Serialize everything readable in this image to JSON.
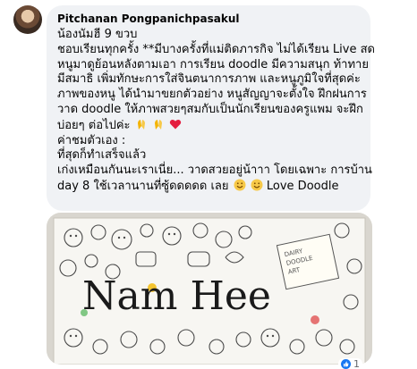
{
  "comment": {
    "author": "Pitchanan Pongpanichpasakul",
    "lines": [
      "น้องนัมฮี 9 ขวบ",
      "ชอบเรียนทุกครั้ง **มีบางครั้งที่แม่ติดภารกิจ ไม่ได้เรียน Live สด",
      "หนูมาดูย้อนหลังตามเอา การเรียน doodle มีความสนุก ท้าทาย",
      "มีสมาธิ เพิ่มทักษะการใส่จินตนาการภาพ และหนูภูมิใจที่สุดค่ะ",
      "ภาพของหนู ได้นำมาขยกตัวอย่าง หนูสัญญาจะตั้งใจ ฝึกฝนการ",
      "วาด doodle ให้ภาพสวยๆสมกับเป็นนักเรียนของครูแพม จะฝึก",
      "บ่อยๆ ต่อไปค่ะ",
      "ค่าชมตัวเอง :",
      "ที่สุดก็ทำเสร็จแล้ว",
      "เก่งเหมือนกันนะเราเนี่ย... วาดสวยอยู่น้าาา โดยเฉพาะ การบ้าน",
      "day 8 ใช้เวลานานที่ซู้ดดดดด เลย",
      " Love Doodle"
    ]
  },
  "photo": {
    "title_text": "Nam Hee",
    "alt": "doodle drawing page"
  },
  "reaction": {
    "count": "1"
  },
  "colors": {
    "bubble_bg": "#f0f2f5",
    "heart": "#e41e3f",
    "like_blue": "#1877f2"
  }
}
